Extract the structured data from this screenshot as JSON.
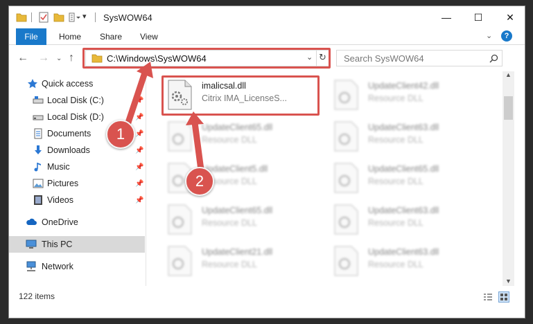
{
  "window": {
    "title": "SysWOW64",
    "controls": {
      "minimize": "—",
      "maximize": "☐",
      "close": "✕"
    }
  },
  "ribbon": {
    "tabs": [
      "File",
      "Home",
      "Share",
      "View"
    ],
    "help": "?"
  },
  "address": {
    "path": "C:\\Windows\\SysWOW64",
    "search_placeholder": "Search SysWOW64"
  },
  "sidebar": {
    "items": [
      {
        "label": "Quick access",
        "icon": "star-icon"
      },
      {
        "label": "Local Disk (C:)",
        "icon": "drive-icon",
        "pinned": true
      },
      {
        "label": "Local Disk (D:)",
        "icon": "drive-icon",
        "pinned": true
      },
      {
        "label": "Documents",
        "icon": "documents-icon",
        "pinned": true
      },
      {
        "label": "Downloads",
        "icon": "download-icon",
        "pinned": true
      },
      {
        "label": "Music",
        "icon": "music-icon",
        "pinned": true
      },
      {
        "label": "Pictures",
        "icon": "pictures-icon",
        "pinned": true
      },
      {
        "label": "Videos",
        "icon": "videos-icon",
        "pinned": true
      },
      {
        "label": "OneDrive",
        "icon": "cloud-icon"
      },
      {
        "label": "This PC",
        "icon": "computer-icon",
        "selected": true
      },
      {
        "label": "Network",
        "icon": "network-icon"
      }
    ]
  },
  "files": [
    {
      "name": "imalicsal.dll",
      "desc": "Citrix IMA_LicenseS...",
      "highlighted": true
    },
    {
      "name": "UpdateClient42.dll",
      "desc": "Resource DLL"
    },
    {
      "name": "UpdateClient65.dll",
      "desc": "Resource DLL"
    },
    {
      "name": "UpdateClient63.dll",
      "desc": "Resource DLL"
    },
    {
      "name": "UpdateClient5.dll",
      "desc": "Resource DLL"
    },
    {
      "name": "UpdateClient65.dll",
      "desc": "Resource DLL"
    },
    {
      "name": "UpdateClient65.dll",
      "desc": "Resource DLL"
    },
    {
      "name": "UpdateClient63.dll",
      "desc": "Resource DLL"
    },
    {
      "name": "UpdateClient21.dll",
      "desc": "Resource DLL"
    },
    {
      "name": "UpdateClient63.dll",
      "desc": "Resource DLL"
    }
  ],
  "status": {
    "count": "122 items"
  },
  "annotations": {
    "step1": "1",
    "step2": "2"
  },
  "colors": {
    "accent": "#1979ca",
    "highlight": "#d9534f"
  }
}
